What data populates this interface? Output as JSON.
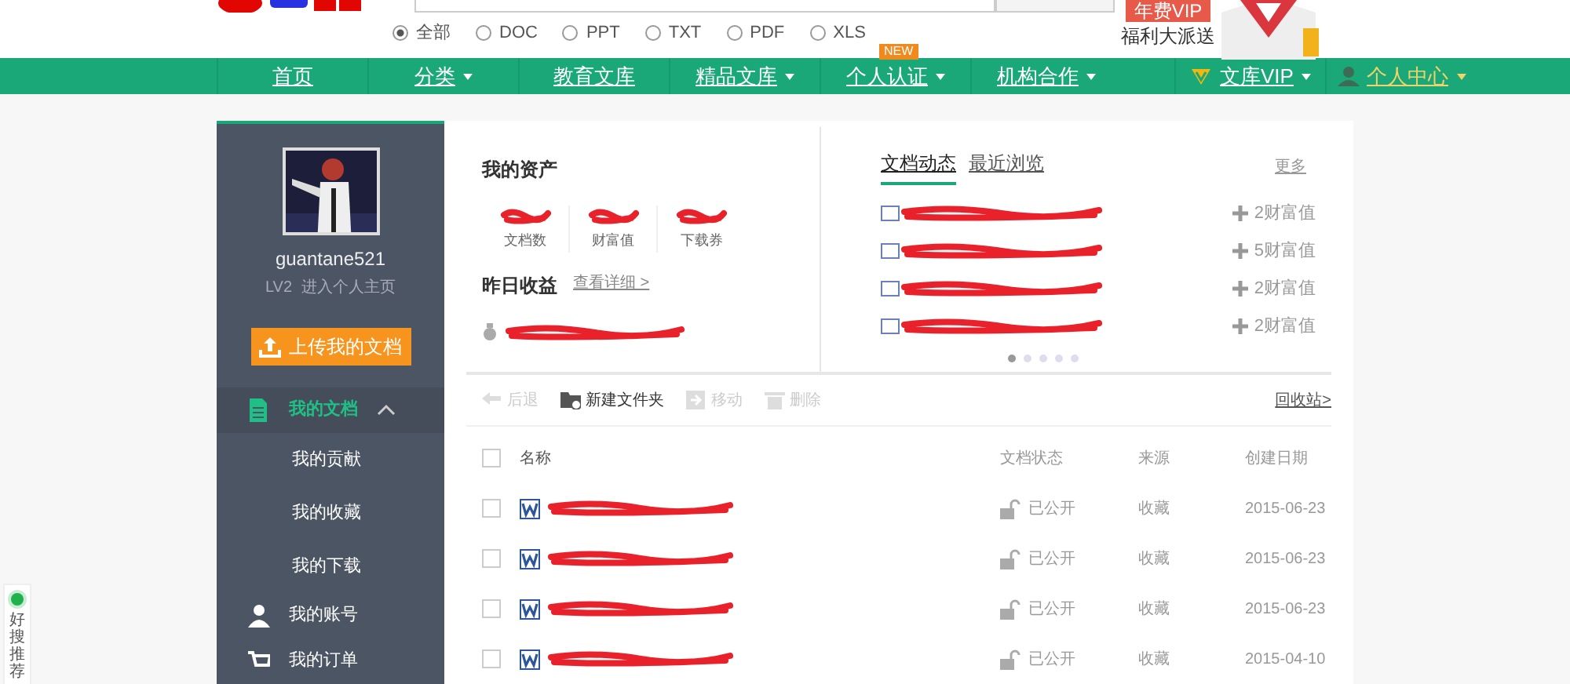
{
  "header": {
    "search_types": [
      {
        "label": "全部",
        "selected": true
      },
      {
        "label": "DOC",
        "selected": false
      },
      {
        "label": "PPT",
        "selected": false
      },
      {
        "label": "TXT",
        "selected": false
      },
      {
        "label": "PDF",
        "selected": false
      },
      {
        "label": "XLS",
        "selected": false
      }
    ],
    "promo": {
      "badge": "年费VIP",
      "text": "福利大派送"
    }
  },
  "nav": [
    {
      "label": "首页",
      "dropdown": false,
      "kind": "plain"
    },
    {
      "label": "分类",
      "dropdown": true,
      "kind": "plain"
    },
    {
      "label": "教育文库",
      "dropdown": false,
      "kind": "plain"
    },
    {
      "label": "精品文库",
      "dropdown": true,
      "kind": "plain"
    },
    {
      "label": "个人认证",
      "dropdown": true,
      "kind": "plain",
      "badge": "NEW"
    },
    {
      "label": "机构合作",
      "dropdown": true,
      "kind": "plain"
    },
    {
      "label": "文库VIP",
      "dropdown": true,
      "kind": "vip"
    },
    {
      "label": "个人中心",
      "dropdown": true,
      "kind": "user"
    }
  ],
  "sidebar": {
    "username": "guantane521",
    "level": "LV2",
    "home_link": "进入个人主页",
    "upload_button": "上传我的文档",
    "menu": [
      {
        "label": "我的文档",
        "kind": "doc",
        "selected": true,
        "expanded": true,
        "children": [
          {
            "label": "我的贡献",
            "selected": false
          },
          {
            "label": "我的收藏",
            "selected": false
          },
          {
            "label": "我的下载",
            "selected": false
          }
        ]
      },
      {
        "label": "我的账号",
        "kind": "account",
        "selected": false
      },
      {
        "label": "我的订单",
        "kind": "cart",
        "selected": false
      }
    ]
  },
  "assets": {
    "title": "我的资产",
    "stats": [
      {
        "label": "文档数"
      },
      {
        "label": "财富值"
      },
      {
        "label": "下载券"
      }
    ],
    "yesterday": {
      "title": "昨日收益",
      "link": "查看详细 >"
    }
  },
  "activity": {
    "tabs": [
      {
        "label": "文档动态",
        "selected": true
      },
      {
        "label": "最近浏览",
        "selected": false
      }
    ],
    "more": "更多",
    "items": [
      {
        "reward": "2财富值"
      },
      {
        "reward": "5财富值"
      },
      {
        "reward": "2财富值"
      },
      {
        "reward": "2财富值"
      }
    ],
    "pager": [
      {
        "selected": true
      },
      {
        "selected": false
      },
      {
        "selected": false
      },
      {
        "selected": false
      },
      {
        "selected": false
      }
    ]
  },
  "toolbar": {
    "buttons": [
      {
        "label": "后退",
        "kind": "back",
        "disabled": true
      },
      {
        "label": "新建文件夹",
        "kind": "folder",
        "disabled": false
      },
      {
        "label": "移动",
        "kind": "move",
        "disabled": true
      },
      {
        "label": "删除",
        "kind": "delete",
        "disabled": true
      }
    ],
    "recycle": "回收站>"
  },
  "table": {
    "select_all": {
      "checked": false
    },
    "columns": [
      "名称",
      "文档状态",
      "来源",
      "创建日期"
    ],
    "rows": [
      {
        "checked": false,
        "status": "已公开",
        "source": "收藏",
        "date": "2015-06-23"
      },
      {
        "checked": false,
        "status": "已公开",
        "source": "收藏",
        "date": "2015-06-23"
      },
      {
        "checked": false,
        "status": "已公开",
        "source": "收藏",
        "date": "2015-06-23"
      },
      {
        "checked": false,
        "status": "已公开",
        "source": "收藏",
        "date": "2015-04-10"
      }
    ]
  },
  "side_widget": {
    "label": "好搜推荐"
  }
}
